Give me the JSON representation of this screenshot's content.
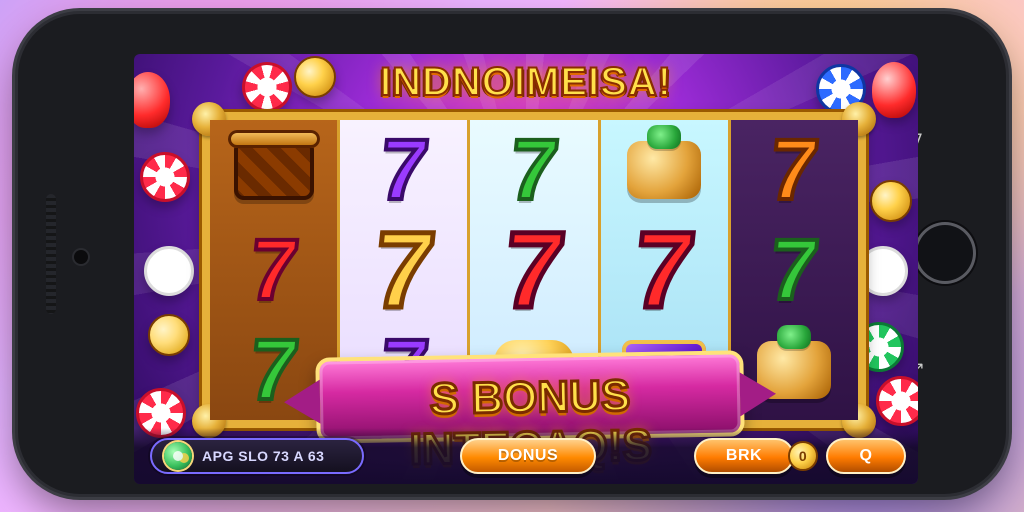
{
  "title": "INDNOIMEISA!",
  "banner": "S BONUS INTECAQ!S",
  "hud": {
    "status_text": "APG SLO 73 A 63",
    "bonus_label": "DONUS",
    "back_label": "BRK",
    "coin_label": "0",
    "search_label": "Q"
  },
  "phone": {
    "top_side_glyph": "7",
    "bottom_side_glyph": "↗"
  },
  "reels": [
    [
      "basket",
      "7",
      "7"
    ],
    [
      "7",
      "7",
      "7"
    ],
    [
      "7",
      "7",
      "nugget"
    ],
    [
      "plate",
      "7",
      "gem"
    ],
    [
      "7",
      "7",
      "plate"
    ]
  ],
  "colors": {
    "title_gold": "#ffe04a",
    "frame_gold": "#e6b13a",
    "bonus_orange": "#ff8a00",
    "purple_bg": "#5a1a9c"
  },
  "icons": {
    "reel_symbols": [
      "basket-icon",
      "seven-icon",
      "plate-icon",
      "gem-icon",
      "nugget-icon"
    ],
    "decorations": [
      "balloon-icon",
      "chip-icon",
      "coin-icon"
    ]
  }
}
